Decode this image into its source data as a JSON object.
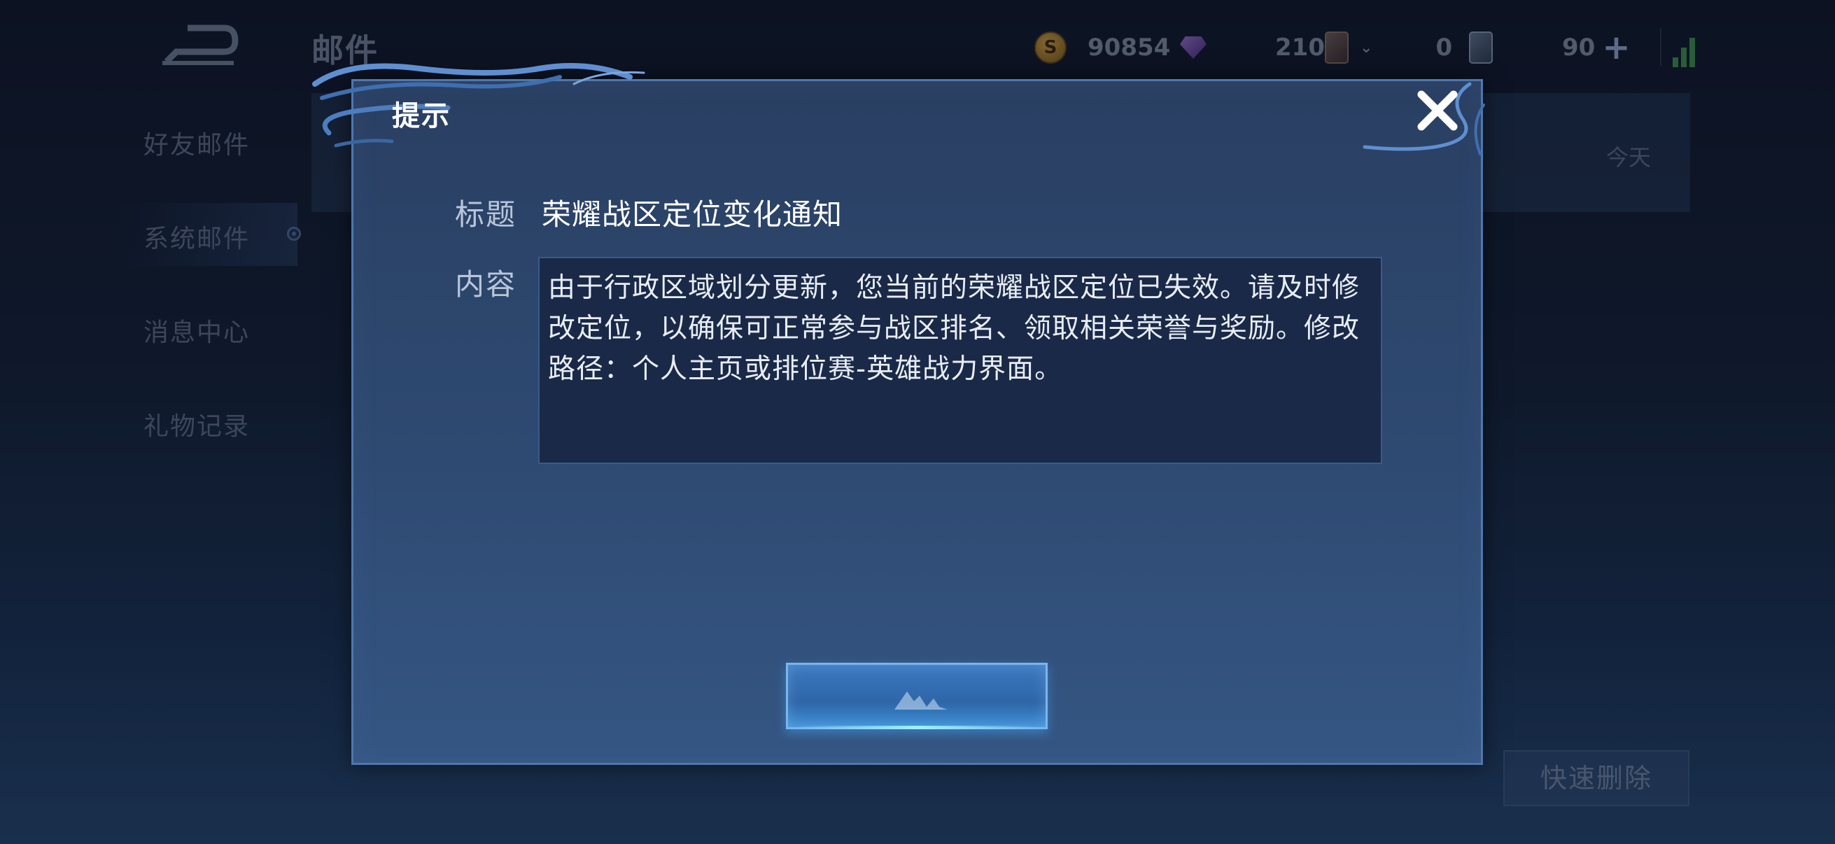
{
  "header": {
    "title": "邮件",
    "currencies": {
      "gold": "90854",
      "diamond": "210",
      "card": "0",
      "voucher": "90"
    }
  },
  "sidebar": {
    "items": [
      {
        "label": "好友邮件"
      },
      {
        "label": "系统邮件"
      },
      {
        "label": "消息中心"
      },
      {
        "label": "礼物记录"
      }
    ],
    "active_index": 1
  },
  "mail_list": {
    "row_date": "今天"
  },
  "footer": {
    "quick_delete_label": "快速删除"
  },
  "dialog": {
    "title": "提示",
    "subject_label": "标题",
    "subject_value": "荣耀战区定位变化通知",
    "content_label": "内容",
    "content_value": "由于行政区域划分更新，您当前的荣耀战区定位已失效。请及时修改定位，以确保可正常参与战区排名、领取相关荣誉与奖励。修改路径：个人主页或排位赛-英雄战力界面。"
  },
  "colors": {
    "accent": "#4f77ad",
    "button": "#3a78c0",
    "button_glow": "#9ef0ff"
  },
  "icons": [
    "back-icon",
    "gold-coin-icon",
    "diamond-icon",
    "card-icon",
    "voucher-icon",
    "plus-icon",
    "signal-icon",
    "close-icon"
  ]
}
